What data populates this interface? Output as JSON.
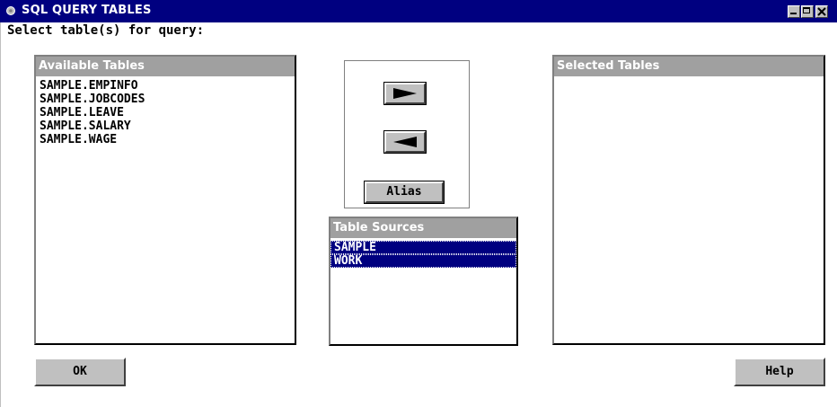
{
  "window": {
    "title": "SQL QUERY TABLES",
    "controls": [
      "minimize-icon",
      "maximize-icon",
      "close-icon"
    ]
  },
  "prompt": "Select table(s) for query:",
  "available": {
    "header": "Available Tables",
    "items": [
      "SAMPLE.EMPINFO",
      "SAMPLE.JOBCODES",
      "SAMPLE.LEAVE",
      "SAMPLE.SALARY",
      "SAMPLE.WAGE"
    ]
  },
  "selected": {
    "header": "Selected Tables",
    "items": []
  },
  "move": {
    "add_icon": "right-arrow-icon",
    "remove_icon": "left-arrow-icon",
    "alias_label": "Alias"
  },
  "sources": {
    "header": "Table Sources",
    "items": [
      "SAMPLE",
      "WORK"
    ],
    "selected": [
      "SAMPLE",
      "WORK"
    ]
  },
  "buttons": {
    "ok_label": "OK",
    "help_label": "Help"
  },
  "colors": {
    "titlebar": "#000080",
    "selection": "#000080",
    "list_header": "#a0a0a0",
    "button_face": "#c0c0c0"
  }
}
